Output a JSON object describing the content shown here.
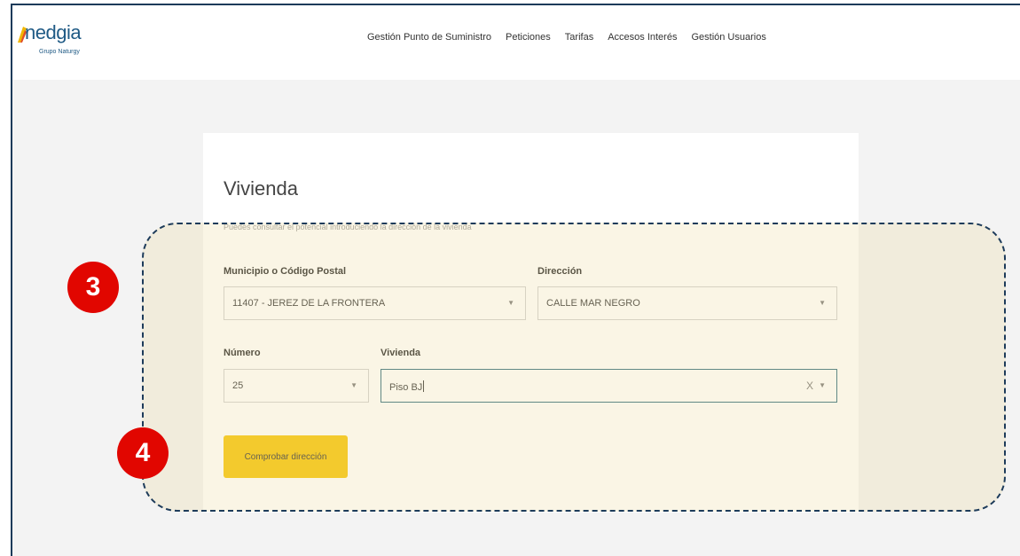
{
  "header": {
    "logo_word": "nedgia",
    "logo_sub": "Grupo Naturgy",
    "nav": [
      {
        "label": "Gestión Punto de Suministro"
      },
      {
        "label": "Peticiones"
      },
      {
        "label": "Tarifas"
      },
      {
        "label": "Accesos Interés"
      },
      {
        "label": "Gestión Usuarios"
      }
    ]
  },
  "form": {
    "title": "Vivienda",
    "subtitle": "Puedes consultar el potencial introduciendo la dirección de la vivienda",
    "municipio": {
      "label": "Municipio o Código Postal",
      "value": "11407 - JEREZ DE LA FRONTERA"
    },
    "direccion": {
      "label": "Dirección",
      "value": "CALLE MAR NEGRO"
    },
    "numero": {
      "label": "Número",
      "value": "25"
    },
    "vivienda": {
      "label": "Vivienda",
      "value": "Piso BJ",
      "clear": "X"
    },
    "submit_label": "Comprobar dirección"
  },
  "annotations": {
    "step_3": "3",
    "step_4": "4",
    "badge_color": "#e10600"
  },
  "colors": {
    "brand": "#1f5a85",
    "button": "#f5c400",
    "highlight_border": "#1d3b5a"
  }
}
